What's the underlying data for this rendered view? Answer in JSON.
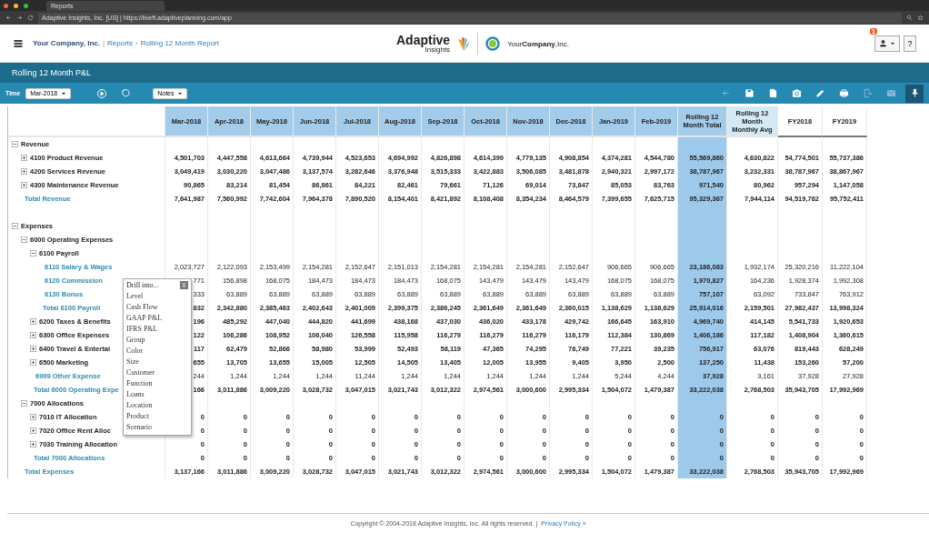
{
  "browser": {
    "tab_title": "Reports",
    "address": "Adaptive Insights, Inc. [US] | https://liveft.adaptiveplanning.com/app"
  },
  "header": {
    "company": "Your Company, Inc.",
    "breadcrumb_separator": "|",
    "crumbs": [
      "Reports",
      "Rolling 12 Month Report"
    ],
    "crumb_arrow": "›",
    "logo_word": "Adaptive",
    "logo_sub": "Insights",
    "partner_logo": "Your**Company**,Inc.",
    "notification_count": "1",
    "help": "?"
  },
  "report_title": "Rolling 12 Month P&L",
  "toolbar": {
    "time_label": "Time",
    "time_value": "Mar-2018",
    "notes_label": "Notes"
  },
  "table": {
    "columns": [
      {
        "label": "Mar-2018",
        "kind": "month"
      },
      {
        "label": "Apr-2018",
        "kind": "month"
      },
      {
        "label": "May-2018",
        "kind": "month"
      },
      {
        "label": "Jun-2018",
        "kind": "month"
      },
      {
        "label": "Jul-2018",
        "kind": "month"
      },
      {
        "label": "Aug-2018",
        "kind": "month"
      },
      {
        "label": "Sep-2018",
        "kind": "month"
      },
      {
        "label": "Oct-2018",
        "kind": "month"
      },
      {
        "label": "Nov-2018",
        "kind": "month"
      },
      {
        "label": "Dec-2018",
        "kind": "month"
      },
      {
        "label": "Jan-2019",
        "kind": "month"
      },
      {
        "label": "Feb-2019",
        "kind": "month"
      },
      {
        "label": "Rolling 12 Month Total",
        "kind": "total"
      },
      {
        "label": "Rolling 12 Month Monthly Avg",
        "kind": "average"
      },
      {
        "label": "FY2018",
        "kind": "fiscal"
      },
      {
        "label": "FY2019",
        "kind": "fiscal"
      }
    ],
    "rows": [
      {
        "kind": "group",
        "label": "Revenue",
        "expanded": true,
        "children": [
          {
            "kind": "line",
            "label": "4100 Product Revenue",
            "expanded": false,
            "values": [
              "4,501,703",
              "4,447,558",
              "4,613,664",
              "4,739,944",
              "4,523,653",
              "4,694,992",
              "4,826,898",
              "4,614,399",
              "4,779,135",
              "4,908,854",
              "4,374,281",
              "4,544,780",
              "55,569,860",
              "4,630,822",
              "54,774,501",
              "55,737,386"
            ]
          },
          {
            "kind": "line",
            "label": "4200 Services Revenue",
            "expanded": false,
            "values": [
              "3,049,419",
              "3,030,220",
              "3,047,486",
              "3,137,574",
              "3,282,646",
              "3,376,948",
              "3,515,333",
              "3,422,883",
              "3,506,085",
              "3,481,878",
              "2,940,321",
              "2,997,172",
              "38,787,967",
              "3,232,331",
              "38,787,967",
              "38,867,967"
            ]
          },
          {
            "kind": "line",
            "label": "4300 Maintenance Revenue",
            "expanded": false,
            "values": [
              "90,865",
              "83,214",
              "81,454",
              "86,861",
              "84,221",
              "82,461",
              "79,661",
              "71,126",
              "69,014",
              "73,847",
              "85,053",
              "83,763",
              "971,540",
              "80,962",
              "957,294",
              "1,147,058"
            ]
          },
          {
            "kind": "total",
            "label": "Total Revenue",
            "values": [
              "7,641,987",
              "7,560,992",
              "7,742,604",
              "7,964,378",
              "7,890,520",
              "8,154,401",
              "8,421,892",
              "8,108,408",
              "8,354,234",
              "8,464,579",
              "7,399,655",
              "7,625,715",
              "95,329,367",
              "7,944,114",
              "94,519,762",
              "95,752,411"
            ]
          }
        ]
      },
      {
        "kind": "group",
        "label": "Expenses",
        "expanded": true,
        "children": [
          {
            "kind": "group",
            "label": "6000 Operating Expenses",
            "expanded": true,
            "children": [
              {
                "kind": "group",
                "label": "6100 Payroll",
                "expanded": true,
                "children": [
                  {
                    "kind": "leaf",
                    "label": "6110 Salary & Wages",
                    "values": [
                      "2,023,727",
                      "2,122,093",
                      "2,153,499",
                      "2,154,281",
                      "2,152,647",
                      "2,151,013",
                      "2,154,281",
                      "2,154,281",
                      "2,154,281",
                      "2,152,647",
                      "906,665",
                      "906,665",
                      "23,186,083",
                      "1,932,174",
                      "25,320,216",
                      "11,222,104"
                    ]
                  },
                  {
                    "kind": "leaf",
                    "label": "6120 Commission",
                    "values": [
                      "771",
                      "156,898",
                      "168,075",
                      "184,473",
                      "184,473",
                      "184,473",
                      "168,075",
                      "143,479",
                      "143,479",
                      "143,479",
                      "168,075",
                      "168,075",
                      "1,970,827",
                      "164,236",
                      "1,928,374",
                      "1,992,308"
                    ]
                  },
                  {
                    "kind": "leaf",
                    "label": "6130 Bonus",
                    "values": [
                      "333",
                      "63,889",
                      "63,889",
                      "63,889",
                      "63,889",
                      "63,889",
                      "63,889",
                      "63,889",
                      "63,889",
                      "63,889",
                      "63,889",
                      "63,889",
                      "757,107",
                      "63,092",
                      "733,847",
                      "763,912"
                    ]
                  },
                  {
                    "kind": "total",
                    "label": "Total 6100 Payroll",
                    "values": [
                      "832",
                      "2,342,880",
                      "2,385,463",
                      "2,402,643",
                      "2,401,009",
                      "2,399,375",
                      "2,386,245",
                      "2,361,649",
                      "2,361,649",
                      "2,360,015",
                      "1,138,629",
                      "1,138,629",
                      "25,914,016",
                      "2,159,501",
                      "27,982,437",
                      "13,998,324"
                    ]
                  }
                ]
              },
              {
                "kind": "line",
                "label": "6200 Taxes & Benefits",
                "expanded": false,
                "values": [
                  "196",
                  "485,292",
                  "447,040",
                  "444,820",
                  "441,699",
                  "438,168",
                  "437,030",
                  "436,020",
                  "433,178",
                  "429,742",
                  "166,645",
                  "163,910",
                  "4,969,740",
                  "414,145",
                  "5,541,733",
                  "1,920,653"
                ]
              },
              {
                "kind": "line",
                "label": "6300 Office Expenses",
                "expanded": false,
                "values": [
                  "122",
                  "106,286",
                  "108,952",
                  "106,040",
                  "126,558",
                  "115,958",
                  "116,279",
                  "116,279",
                  "116,279",
                  "116,179",
                  "112,384",
                  "130,869",
                  "1,406,186",
                  "117,182",
                  "1,408,904",
                  "1,360,615"
                ]
              },
              {
                "kind": "line",
                "label": "6400 Travel & Entertai",
                "expanded": false,
                "values": [
                  "117",
                  "62,479",
                  "52,866",
                  "58,980",
                  "53,999",
                  "52,493",
                  "58,119",
                  "47,365",
                  "74,295",
                  "78,749",
                  "77,221",
                  "39,235",
                  "756,917",
                  "63,076",
                  "819,443",
                  "628,249"
                ]
              },
              {
                "kind": "line",
                "label": "6500 Marketing",
                "expanded": false,
                "values": [
                  "655",
                  "13,705",
                  "13,655",
                  "15,005",
                  "12,505",
                  "14,505",
                  "13,405",
                  "12,005",
                  "13,955",
                  "9,405",
                  "3,950",
                  "2,500",
                  "137,250",
                  "11,438",
                  "153,260",
                  "57,200"
                ]
              },
              {
                "kind": "leaf",
                "label": "6999 Other Expense",
                "values": [
                  "244",
                  "1,244",
                  "1,244",
                  "1,244",
                  "11,244",
                  "1,244",
                  "1,244",
                  "1,244",
                  "1,244",
                  "1,244",
                  "5,244",
                  "4,244",
                  "37,928",
                  "3,161",
                  "37,928",
                  "27,928"
                ]
              },
              {
                "kind": "total",
                "label": "Total 6000 Operating Expe",
                "values": [
                  "166",
                  "3,011,886",
                  "3,009,220",
                  "3,028,732",
                  "3,047,015",
                  "3,021,743",
                  "3,012,322",
                  "2,974,561",
                  "3,000,600",
                  "2,995,334",
                  "1,504,072",
                  "1,479,387",
                  "33,222,038",
                  "2,768,503",
                  "35,943,705",
                  "17,992,969"
                ]
              }
            ]
          },
          {
            "kind": "group",
            "label": "7000 Allocations",
            "expanded": true,
            "children": [
              {
                "kind": "line",
                "label": "7010 IT Allocation",
                "expanded": false,
                "values": [
                  "0",
                  "0",
                  "0",
                  "0",
                  "0",
                  "0",
                  "0",
                  "0",
                  "0",
                  "0",
                  "0",
                  "0",
                  "0",
                  "0",
                  "0",
                  "0"
                ]
              },
              {
                "kind": "line",
                "label": "7020 Office Rent Alloc",
                "expanded": false,
                "values": [
                  "0",
                  "0",
                  "0",
                  "0",
                  "0",
                  "0",
                  "0",
                  "0",
                  "0",
                  "0",
                  "0",
                  "0",
                  "0",
                  "0",
                  "0",
                  "0"
                ]
              },
              {
                "kind": "line",
                "label": "7030 Training Allocation",
                "expanded": false,
                "values": [
                  "0",
                  "0",
                  "0",
                  "0",
                  "0",
                  "0",
                  "0",
                  "0",
                  "0",
                  "0",
                  "0",
                  "0",
                  "0",
                  "0",
                  "0",
                  "0"
                ]
              },
              {
                "kind": "total",
                "label": "Total 7000 Allocations",
                "values": [
                  "0",
                  "0",
                  "0",
                  "0",
                  "0",
                  "0",
                  "0",
                  "0",
                  "0",
                  "0",
                  "0",
                  "0",
                  "0",
                  "0",
                  "0",
                  "0"
                ]
              }
            ]
          },
          {
            "kind": "total",
            "label": "Total Expenses",
            "values": [
              "3,137,166",
              "3,011,886",
              "3,009,220",
              "3,028,732",
              "3,047,015",
              "3,021,743",
              "3,012,322",
              "2,974,561",
              "3,000,600",
              "2,995,334",
              "1,504,072",
              "1,479,387",
              "33,222,038",
              "2,768,503",
              "35,943,705",
              "17,992,969"
            ]
          }
        ]
      }
    ]
  },
  "drill_menu": {
    "title": "Drill into...",
    "close": "X",
    "items": [
      "Level",
      "Cash Flow",
      "GAAP P&L",
      "IFRS P&L",
      "Group",
      "Color",
      "Size",
      "Customer",
      "Function",
      "Loans",
      "Location",
      "Product",
      "Scenario"
    ]
  },
  "footer": {
    "copyright": "Copyright © 2004-2018 Adaptive Insights, Inc. All rights reserved. |",
    "link": "Privacy Policy »"
  }
}
